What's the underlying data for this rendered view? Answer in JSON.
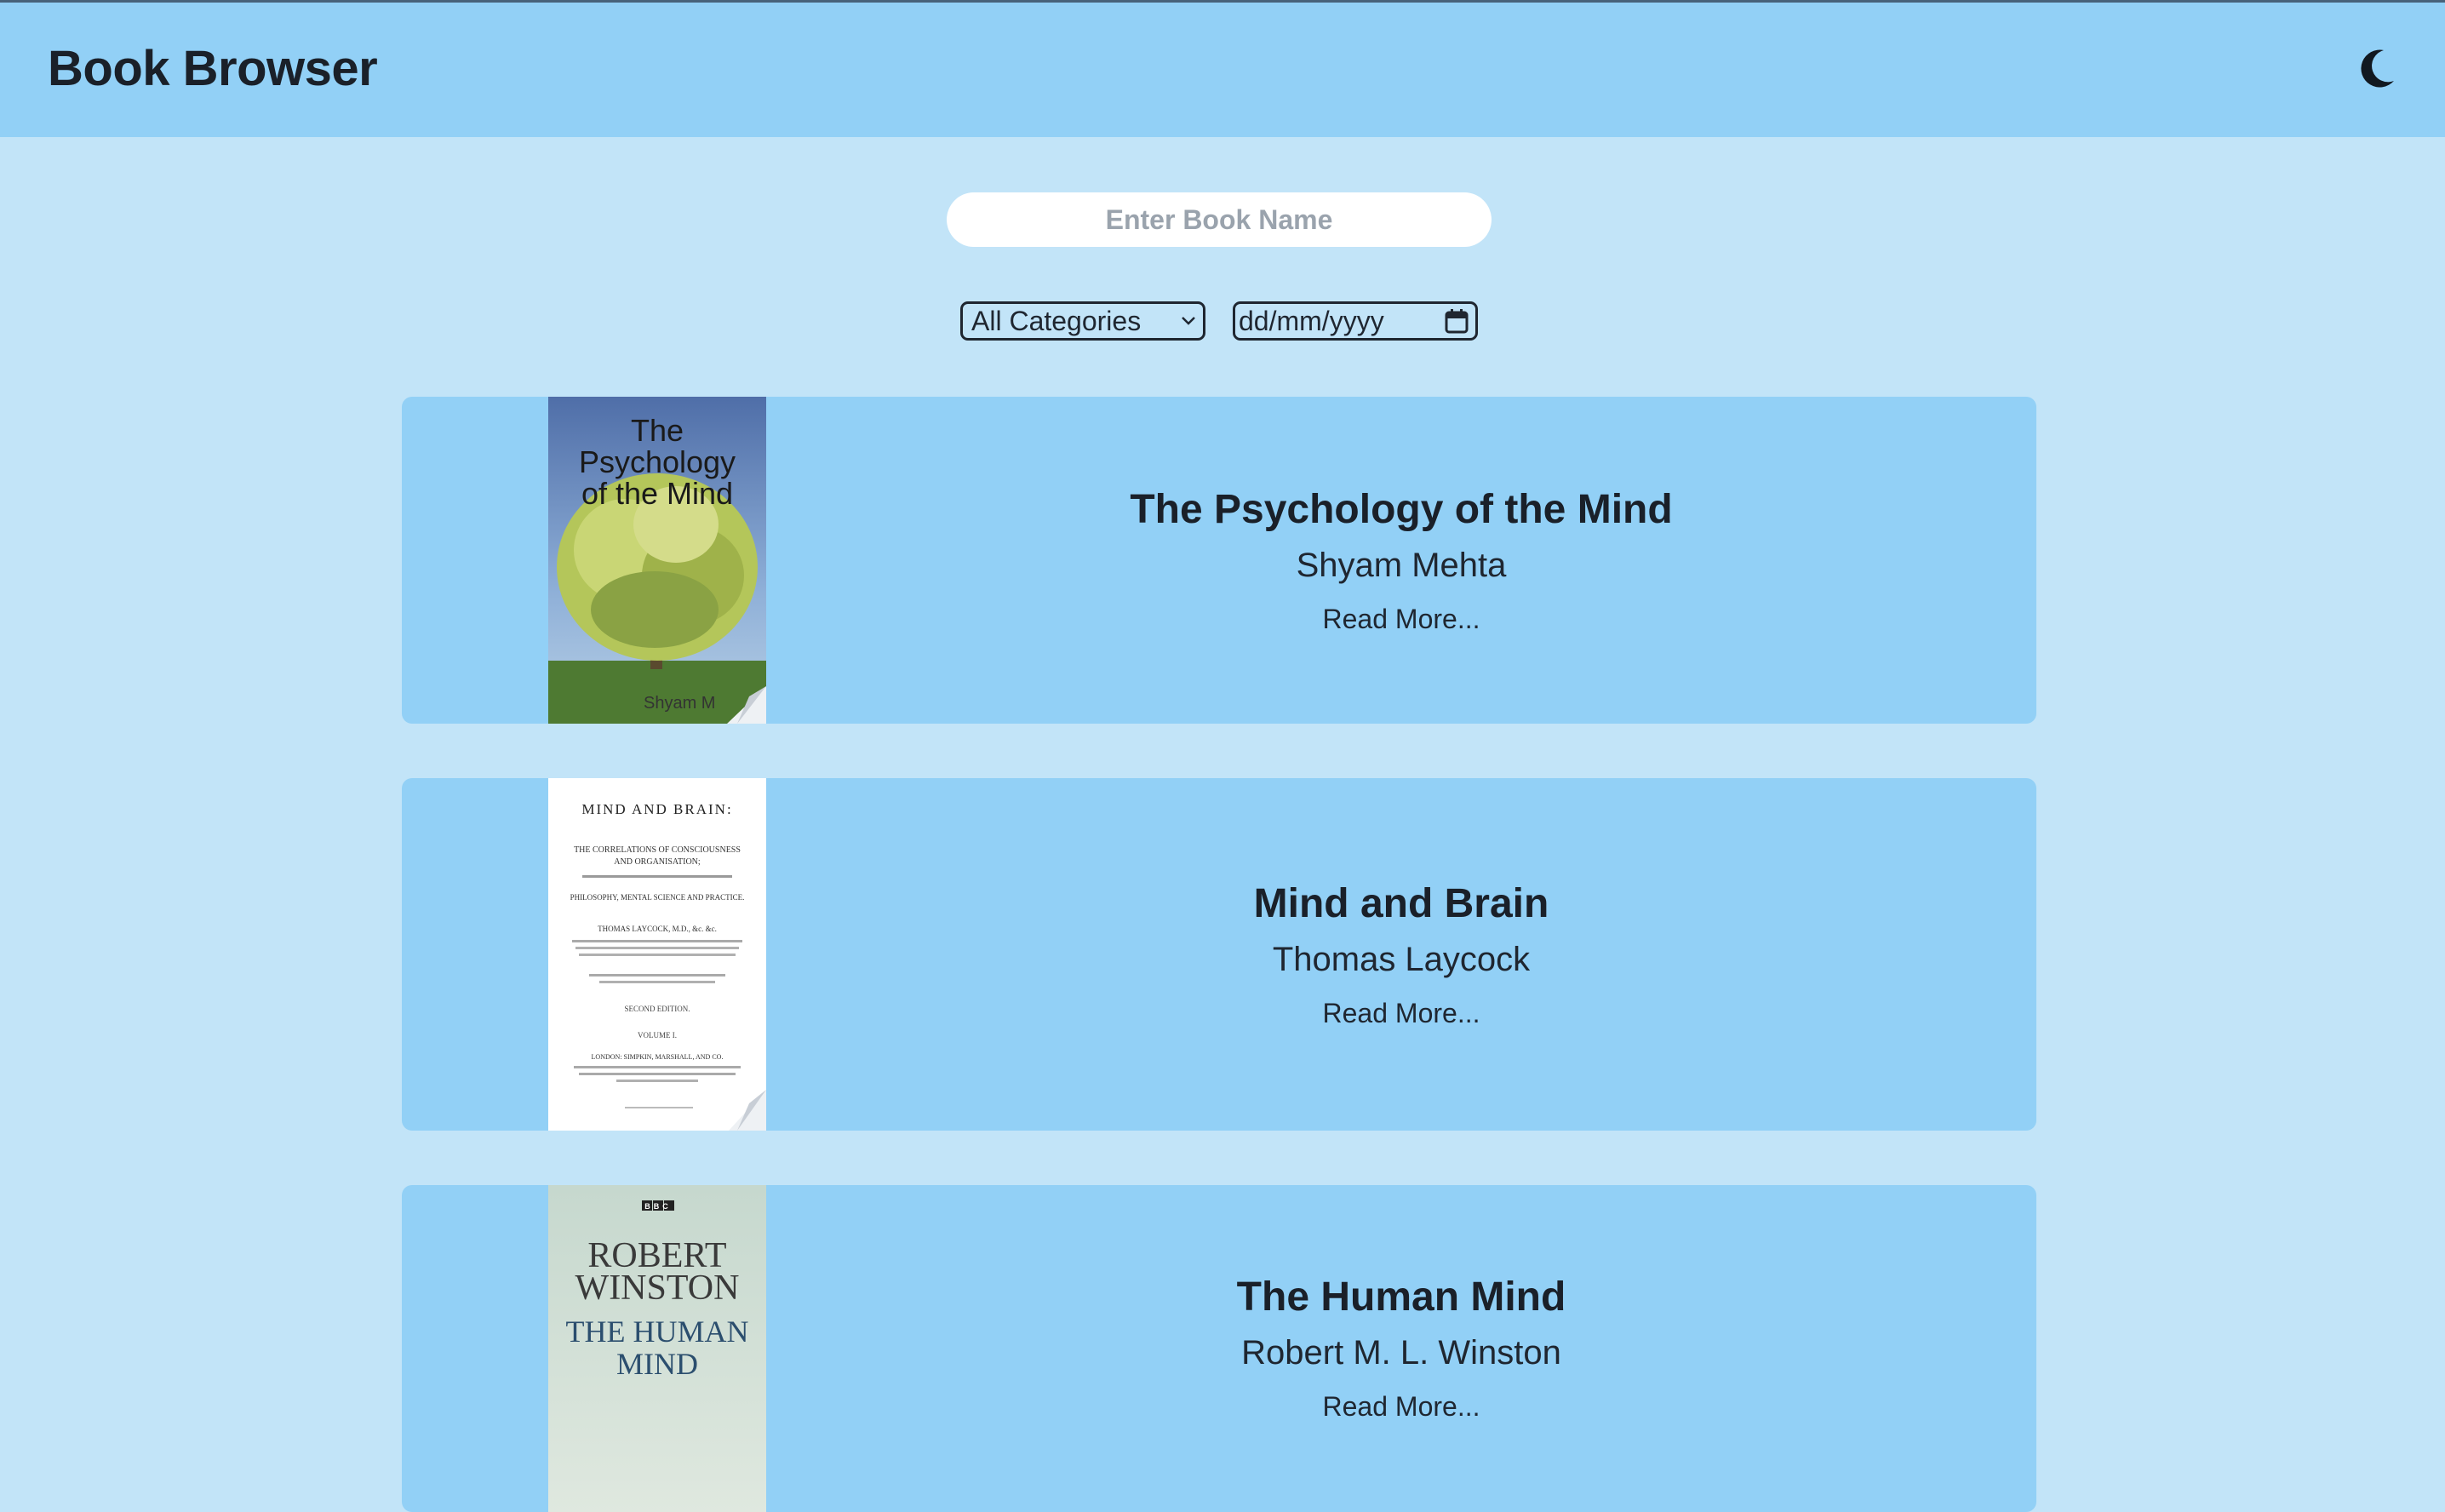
{
  "header": {
    "title": "Book Browser",
    "theme_icon": "moon-icon"
  },
  "search": {
    "placeholder": "Enter Book Name",
    "value": ""
  },
  "filters": {
    "category_selected": "All Categories",
    "date_placeholder": "dd/mm/yyyy"
  },
  "books": [
    {
      "title": "The Psychology of the Mind",
      "author": "Shyam Mehta",
      "read_more": "Read More...",
      "cover_lines": [
        "The",
        "Psychology",
        "of the Mind"
      ],
      "cover_footer": "Shyam M"
    },
    {
      "title": "Mind and Brain",
      "author": "Thomas Laycock",
      "read_more": "Read More...",
      "cover_lines": [
        "MIND AND BRAIN:",
        "THE CORRELATIONS OF CONSCIOUSNESS",
        "AND ORGANISATION;",
        "PHILOSOPHY, MENTAL SCIENCE AND PRACTICE.",
        "THOMAS LAYCOCK, M.D., &c. &c.",
        "SECOND EDITION.",
        "VOLUME I.",
        "LONDON: SIMPKIN, MARSHALL, AND CO."
      ]
    },
    {
      "title": "The Human Mind",
      "author": "Robert M. L. Winston",
      "read_more": "Read More...",
      "cover_badge": "BBC",
      "cover_lines": [
        "ROBERT",
        "WINSTON",
        "THE HUMAN",
        "MIND"
      ]
    }
  ],
  "colors": {
    "page_bg": "#c2e4f8",
    "header_bg": "#92d0f6",
    "card_bg": "#92d0f6",
    "text": "#1a2029"
  }
}
